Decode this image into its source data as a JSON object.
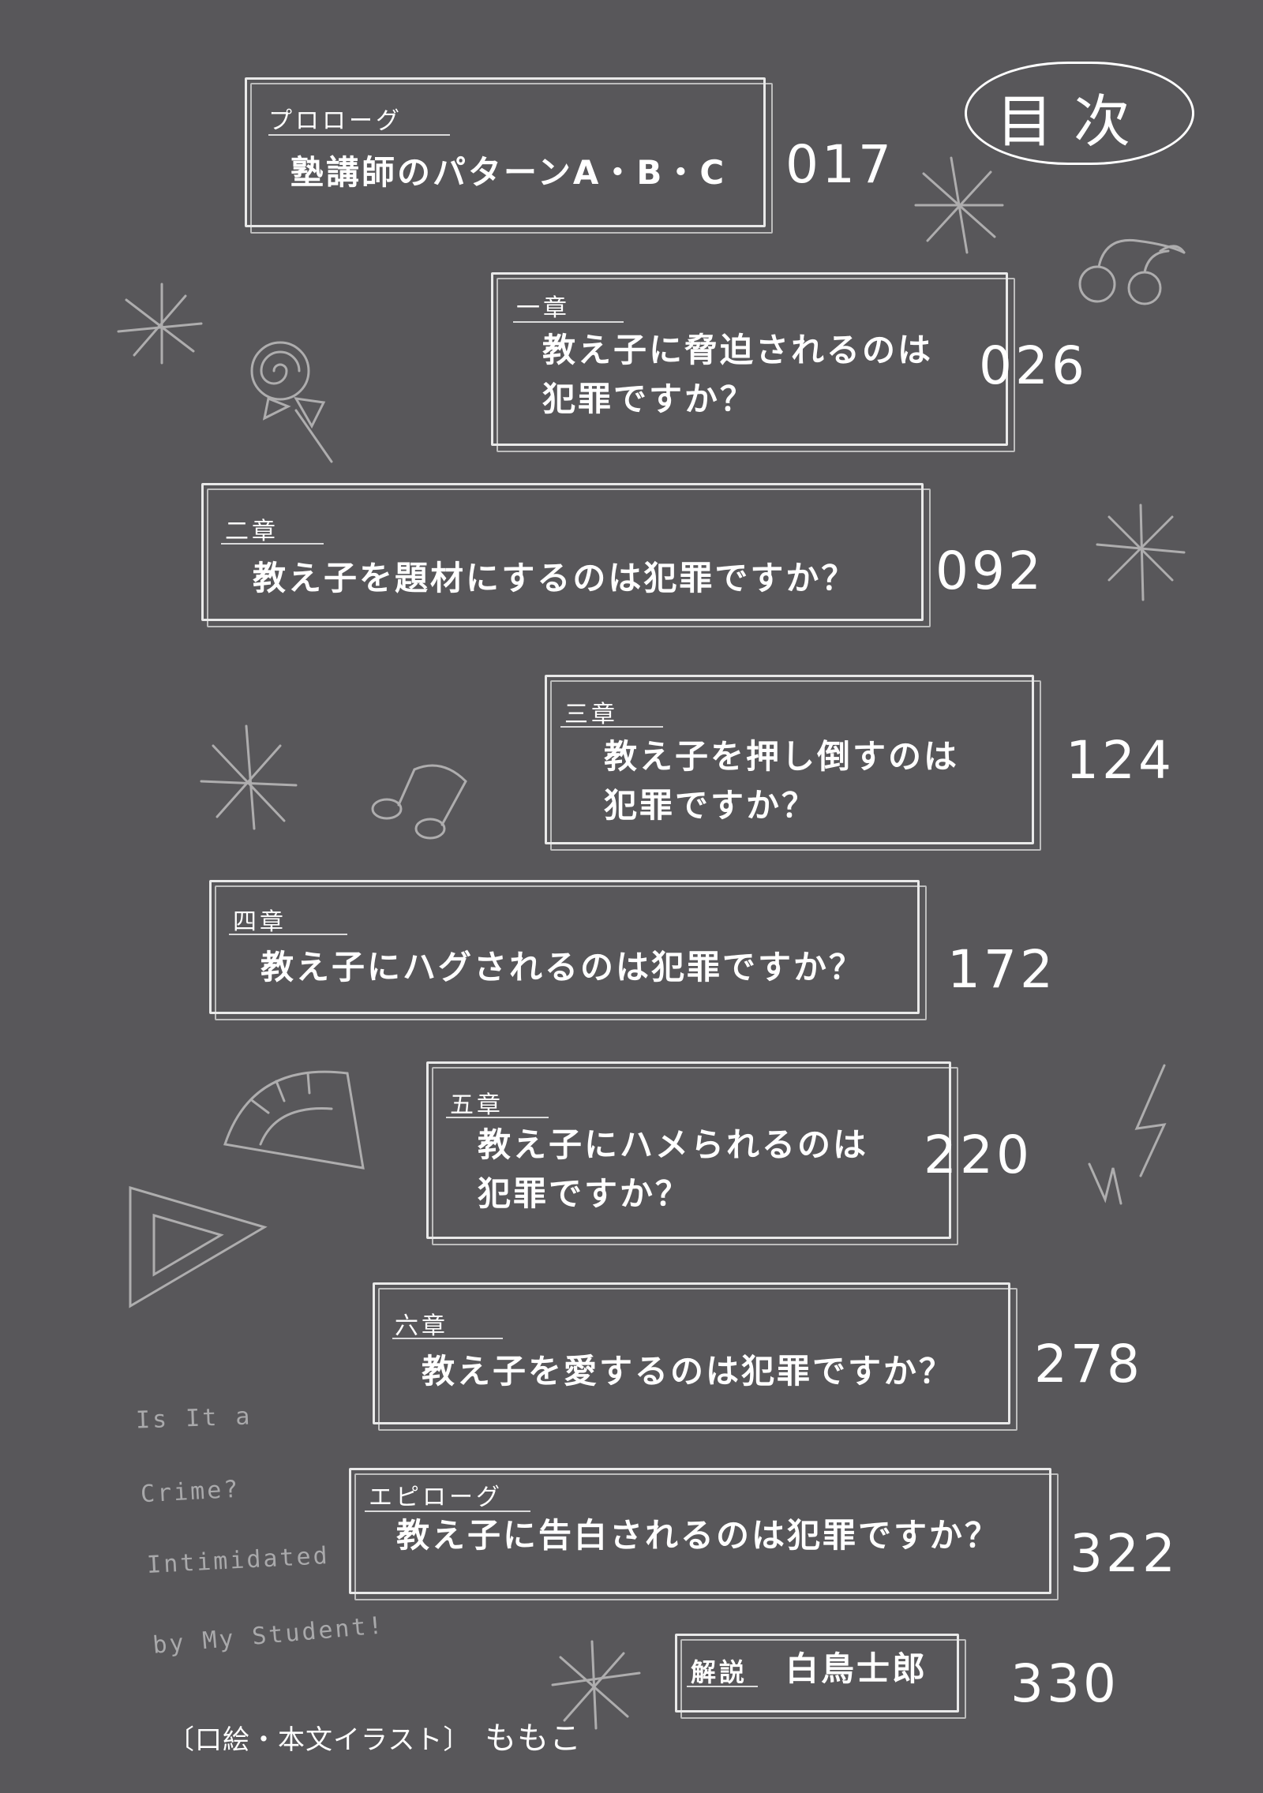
{
  "header": {
    "title": "目次"
  },
  "toc": [
    {
      "label": "プロローグ",
      "lines": [
        "塾講師のパターンA・B・C"
      ],
      "page": "017"
    },
    {
      "label": "一章",
      "lines": [
        "教え子に脅迫されるのは",
        "犯罪ですか？"
      ],
      "page": "026"
    },
    {
      "label": "二章",
      "lines": [
        "教え子を題材にするのは犯罪ですか？"
      ],
      "page": "092"
    },
    {
      "label": "三章",
      "lines": [
        "教え子を押し倒すのは",
        "犯罪ですか？"
      ],
      "page": "124"
    },
    {
      "label": "四章",
      "lines": [
        "教え子にハグされるのは犯罪ですか？"
      ],
      "page": "172"
    },
    {
      "label": "五章",
      "lines": [
        "教え子にハメられるのは",
        "犯罪ですか？"
      ],
      "page": "220"
    },
    {
      "label": "六章",
      "lines": [
        "教え子を愛するのは犯罪ですか？"
      ],
      "page": "278"
    },
    {
      "label": "エピローグ",
      "lines": [
        "教え子に告白されるのは犯罪ですか？"
      ],
      "page": "322"
    },
    {
      "label": "解説",
      "lines": [
        "白鳥士郎"
      ],
      "page": "330"
    }
  ],
  "english_title": [
    "Is It a",
    "Crime?",
    "Intimidated",
    "by My Student!"
  ],
  "credit": {
    "role": "口絵・本文イラスト",
    "name": "ももこ"
  }
}
